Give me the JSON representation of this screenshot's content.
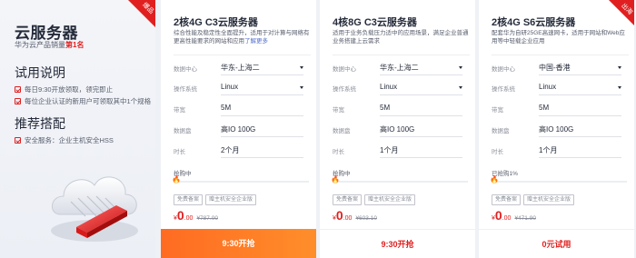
{
  "left": {
    "ribbon": "爆品",
    "title": "云服务器",
    "sales_prefix": "华为云产品销量",
    "sales_rank": "第1名",
    "trial_heading": "试用说明",
    "rules": [
      "每日9:30开放领取，领完即止",
      "每位企业认证的新用户可领取其中1个规格"
    ],
    "combo_heading": "推荐搭配",
    "combo_item": "安全服务：企业主机安全HSS"
  },
  "cards": [
    {
      "title": "2核4G C3云服务器",
      "desc": "综合性能及稳定性全面提升，适用于对计算与网络有更高性能要求的网站和应用",
      "desc_link": "了解更多",
      "rows": [
        {
          "label": "数据中心",
          "value": "华东-上海二"
        },
        {
          "label": "操作系统",
          "value": "Linux"
        },
        {
          "label": "带宽",
          "value": "5M"
        },
        {
          "label": "数据盘",
          "value": "高IO 100G"
        },
        {
          "label": "时长",
          "value": "2个月"
        }
      ],
      "buying_label": "抢购中",
      "tags": [
        "免费备案",
        "赠主机安全企业版"
      ],
      "price_currency": "¥",
      "price_int": "0",
      "price_dec": ".00",
      "original_price": "¥787.00",
      "button": "9:30开抢"
    },
    {
      "title": "4核8G C3云服务器",
      "desc": "适用于业务负载压力适中的应用场景，满足企业普通业务搭建上云需求",
      "rows": [
        {
          "label": "数据中心",
          "value": "华东-上海二"
        },
        {
          "label": "操作系统",
          "value": "Linux"
        },
        {
          "label": "带宽",
          "value": "5M"
        },
        {
          "label": "数据盘",
          "value": "高IO 100G"
        },
        {
          "label": "时长",
          "value": "1个月"
        }
      ],
      "buying_label": "抢购中",
      "tags": [
        "免费备案",
        "赠主机安全企业版"
      ],
      "price_currency": "¥",
      "price_int": "0",
      "price_dec": ".00",
      "original_price": "¥603.10",
      "button": "9:30开抢"
    },
    {
      "badge": "出海",
      "title": "2核4G S6云服务器",
      "desc": "配套华为自研25GE高速网卡，适用于网站和Web应用等中轻载企业应用",
      "rows": [
        {
          "label": "数据中心",
          "value": "中国-香港"
        },
        {
          "label": "操作系统",
          "value": "Linux"
        },
        {
          "label": "带宽",
          "value": "5M"
        },
        {
          "label": "数据盘",
          "value": "高IO 100G"
        },
        {
          "label": "时长",
          "value": "1个月"
        }
      ],
      "buying_label": "已抢购1%",
      "tags": [
        "免费备案",
        "赠主机安全企业版"
      ],
      "price_currency": "¥",
      "price_int": "0",
      "price_dec": ".00",
      "original_price": "¥471.90",
      "button": "0元试用"
    }
  ],
  "colors": {
    "accent_red": "#e02020",
    "accent_orange": "#ff6b22",
    "text_primary": "#252b3a",
    "text_secondary": "#575d6c"
  }
}
